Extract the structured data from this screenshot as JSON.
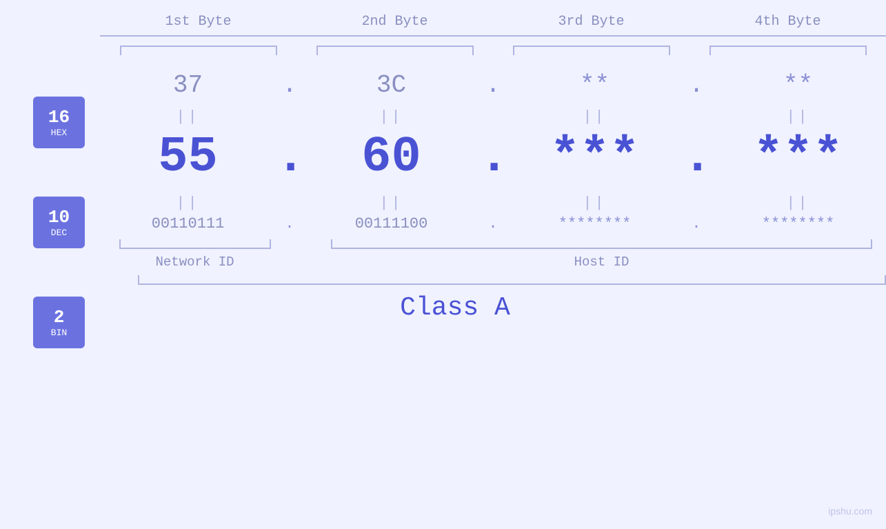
{
  "page": {
    "background": "#f0f2ff",
    "watermark": "ipshu.com"
  },
  "byte_headers": [
    {
      "label": "1st Byte"
    },
    {
      "label": "2nd Byte"
    },
    {
      "label": "3rd Byte"
    },
    {
      "label": "4th Byte"
    }
  ],
  "badges": [
    {
      "num": "16",
      "label": "HEX"
    },
    {
      "num": "10",
      "label": "DEC"
    },
    {
      "num": "2",
      "label": "BIN"
    }
  ],
  "hex_row": {
    "b1": "37",
    "b2": "3C",
    "b3": "**",
    "b4": "**",
    "dots": [
      ".",
      ".",
      "."
    ]
  },
  "dec_row": {
    "b1": "55",
    "b2": "60",
    "b3": "***",
    "b4": "***",
    "dots": [
      ".",
      ".",
      "."
    ]
  },
  "bin_row": {
    "b1": "00110111",
    "b2": "00111100",
    "b3": "********",
    "b4": "********",
    "dots": [
      ".",
      ".",
      "."
    ]
  },
  "labels": {
    "network_id": "Network ID",
    "host_id": "Host ID",
    "class": "Class A"
  },
  "separators": {
    "symbol": "||"
  }
}
